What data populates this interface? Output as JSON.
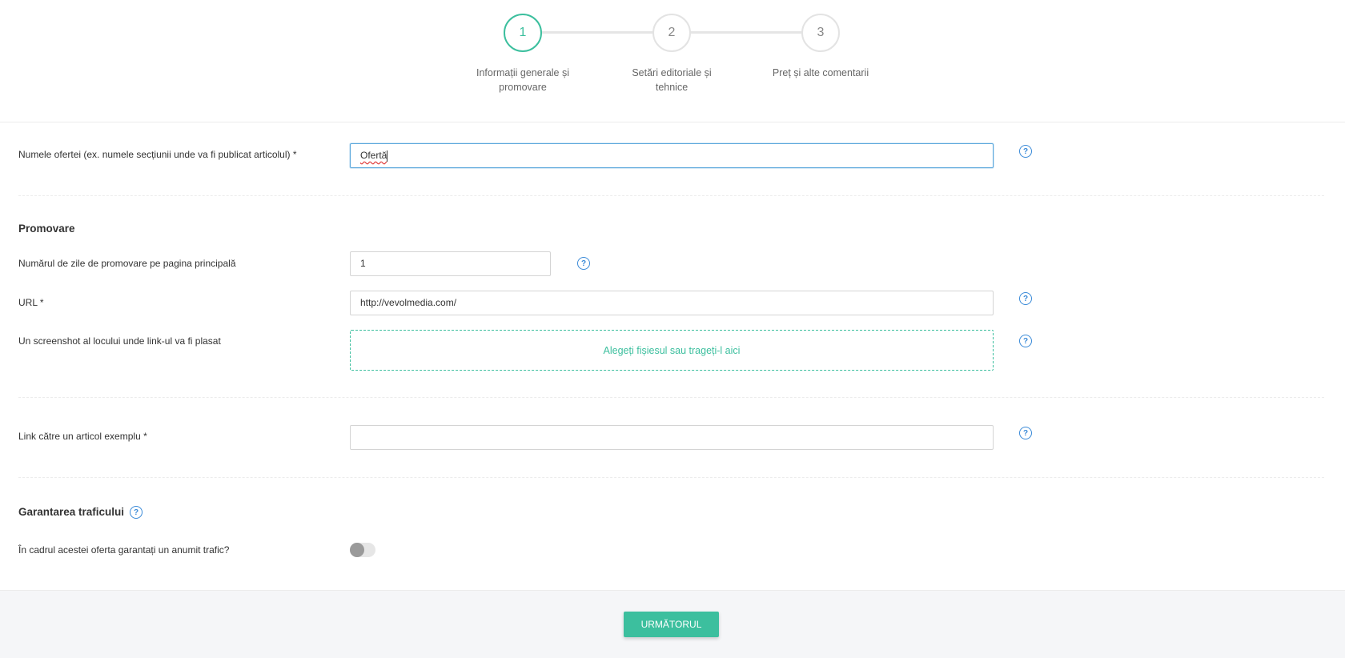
{
  "stepper": {
    "steps": [
      {
        "number": "1",
        "label_line1": "Informații generale și",
        "label_line2": "promovare",
        "active": true
      },
      {
        "number": "2",
        "label_line1": "Setări editoriale și",
        "label_line2": "tehnice",
        "active": false
      },
      {
        "number": "3",
        "label_line1": "Preț și alte comentarii",
        "label_line2": "",
        "active": false
      }
    ]
  },
  "offer_name": {
    "label": "Numele ofertei (ex. numele secțiunii unde va fi publicat articolul) *",
    "value": "Ofertă"
  },
  "promotion": {
    "title": "Promovare",
    "days_label": "Numărul de zile de promovare pe pagina principală",
    "days_value": "1",
    "url_label": "URL *",
    "url_value": "http://vevolmedia.com/",
    "screenshot_label": "Un screenshot al locului unde link-ul va fi plasat",
    "dropzone_text": "Alegeți fișiesul sau trageți-l aici"
  },
  "example_link": {
    "label": "Link către un articol exemplu *",
    "value": ""
  },
  "traffic": {
    "title": "Garantarea traficului",
    "question": "În cadrul acestei oferta garantați un anumit trafic?",
    "toggle_on": false
  },
  "help_icon": "?",
  "footer": {
    "next_label": "URMĂTORUL"
  },
  "colors": {
    "accent": "#3cbf9e",
    "help": "#3a8ad8",
    "focus_border": "#5aa7dc"
  }
}
